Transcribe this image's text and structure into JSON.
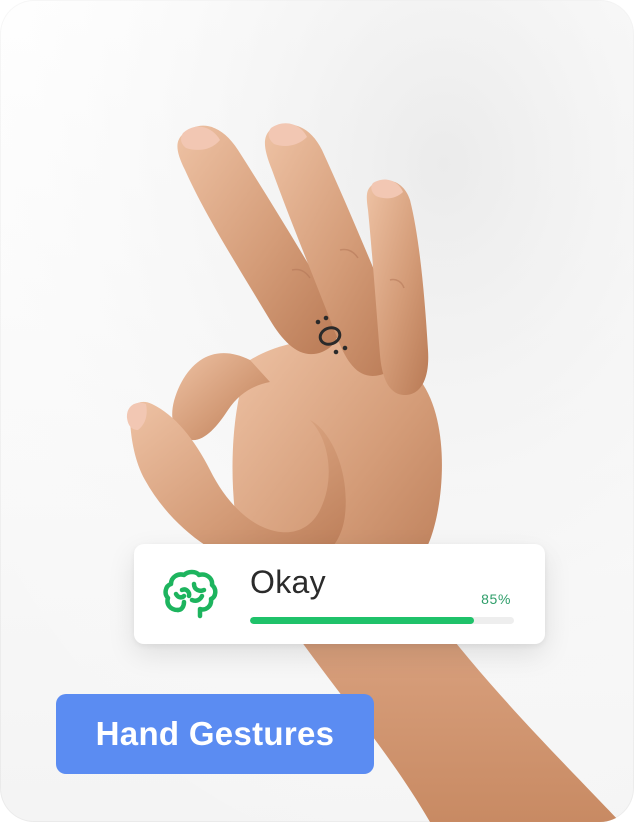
{
  "detection": {
    "icon": "brain-icon",
    "gesture_label": "Okay",
    "confidence_text": "85%",
    "confidence": 0.85
  },
  "tag": {
    "label": "Hand Gestures"
  },
  "photo": {
    "subject": "hand-ok-gesture-icon"
  },
  "colors": {
    "accent_green": "#1fc26a",
    "icon_green": "#1db45e",
    "button_blue": "#5b8cf2"
  }
}
